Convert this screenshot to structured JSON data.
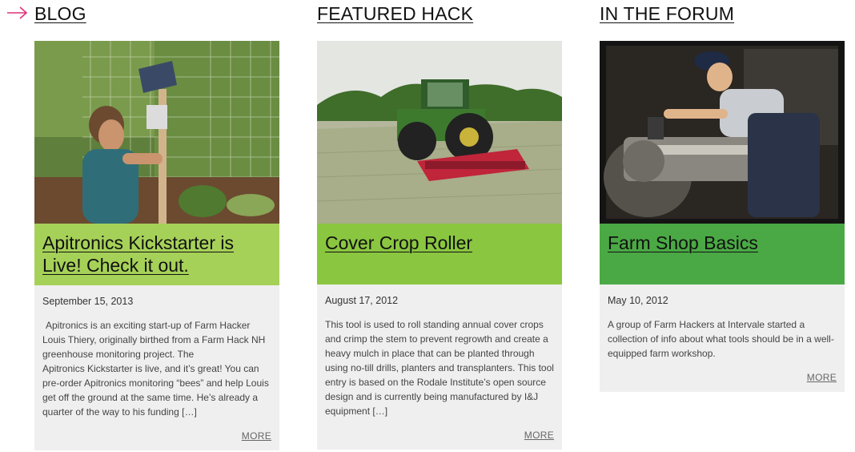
{
  "colors": {
    "arrow": "#e0317a",
    "blog_header_bg": "#a6d158",
    "hack_header_bg": "#8ac640",
    "forum_header_bg": "#4aa944",
    "card_body_bg": "#efefef"
  },
  "columns": [
    {
      "section_title": "BLOG",
      "image_alt": "Person installing a solar-powered monitoring device near a trellis",
      "headline": "Apitronics Kickstarter is Live! Check it out.",
      "date": "September 15, 2013",
      "excerpt_lines": [
        "Apitronics is an exciting start-up of Farm Hacker Louis Thiery, originally birthed from a Farm Hack NH greenhouse monitoring project. The",
        "Apitronics Kickstarter is live, and it’s great! You can pre-order Apitronics monitoring “bees” and help Louis get off the ground at the same time. He’s already a quarter of the way to his funding […]"
      ],
      "more_label": "MORE"
    },
    {
      "section_title": "FEATURED HACK",
      "image_alt": "Tractor pulling a red cover crop roller through a field",
      "headline": "Cover Crop Roller",
      "date": "August 17, 2012",
      "excerpt": "This tool is used to roll standing annual cover crops and crimp the stem to prevent regrowth and create a heavy mulch in place that can be planted through using no-till drills, planters and transplanters. This tool entry is based on the Rodale Institute’s open source design and is currently being manufactured by I&J equipment […]",
      "more_label": "MORE"
    },
    {
      "section_title": "IN THE FORUM",
      "image_alt": "Vintage photo of a woman working at a lathe",
      "headline": "Farm Shop Basics",
      "date": "May 10, 2012",
      "excerpt": "A group of Farm Hackers at Intervale started a collection of info about what tools should be in a well-equipped farm workshop.",
      "more_label": "MORE"
    }
  ]
}
